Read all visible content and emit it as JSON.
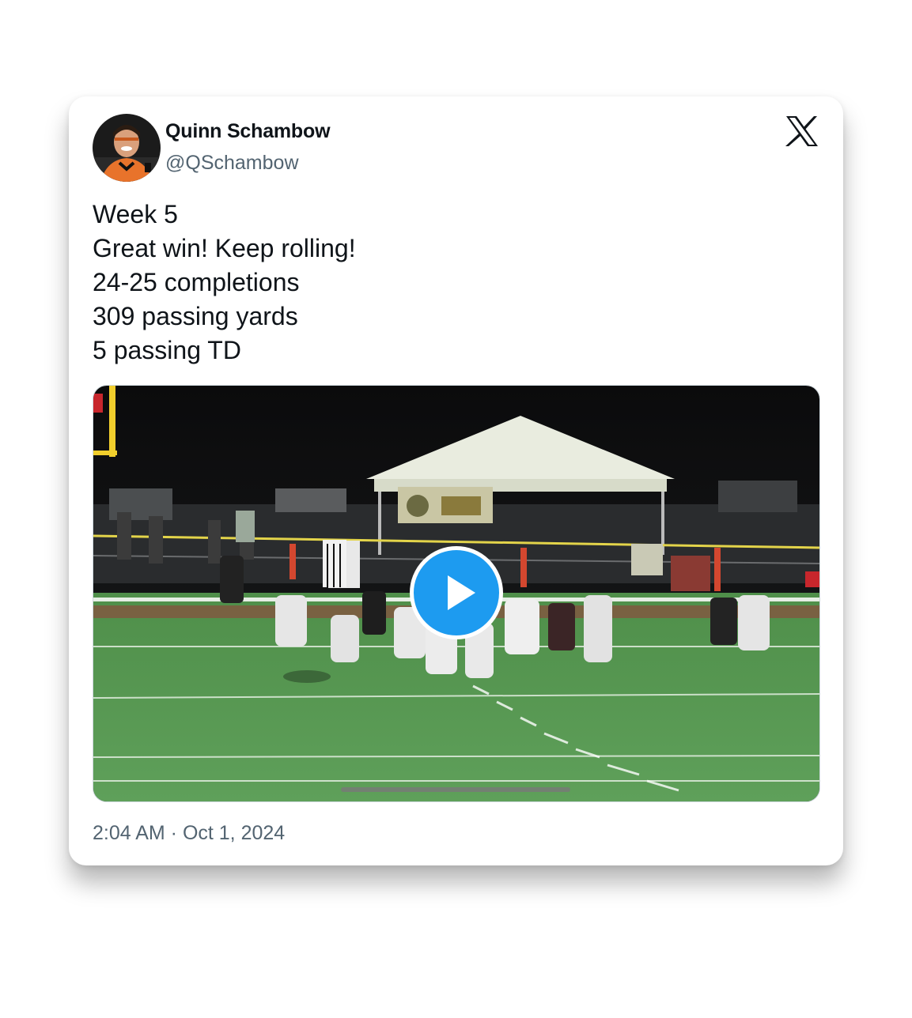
{
  "author": {
    "name": "Quinn Schambow",
    "handle": "@QSchambow",
    "avatar_icon": "avatar-photo"
  },
  "platform_icon": "x-logo-icon",
  "tweet": {
    "lines": [
      "Week 5",
      "Great win! Keep rolling!",
      "24-25 completions",
      "309 passing yards",
      "5 passing TD"
    ]
  },
  "media": {
    "type": "video",
    "play_icon": "play-icon",
    "progress": 0.0
  },
  "timestamp": "2:04 AM · Oct 1, 2024",
  "colors": {
    "accent": "#1d9bf0",
    "text_primary": "#0f1419",
    "text_secondary": "#536471"
  }
}
